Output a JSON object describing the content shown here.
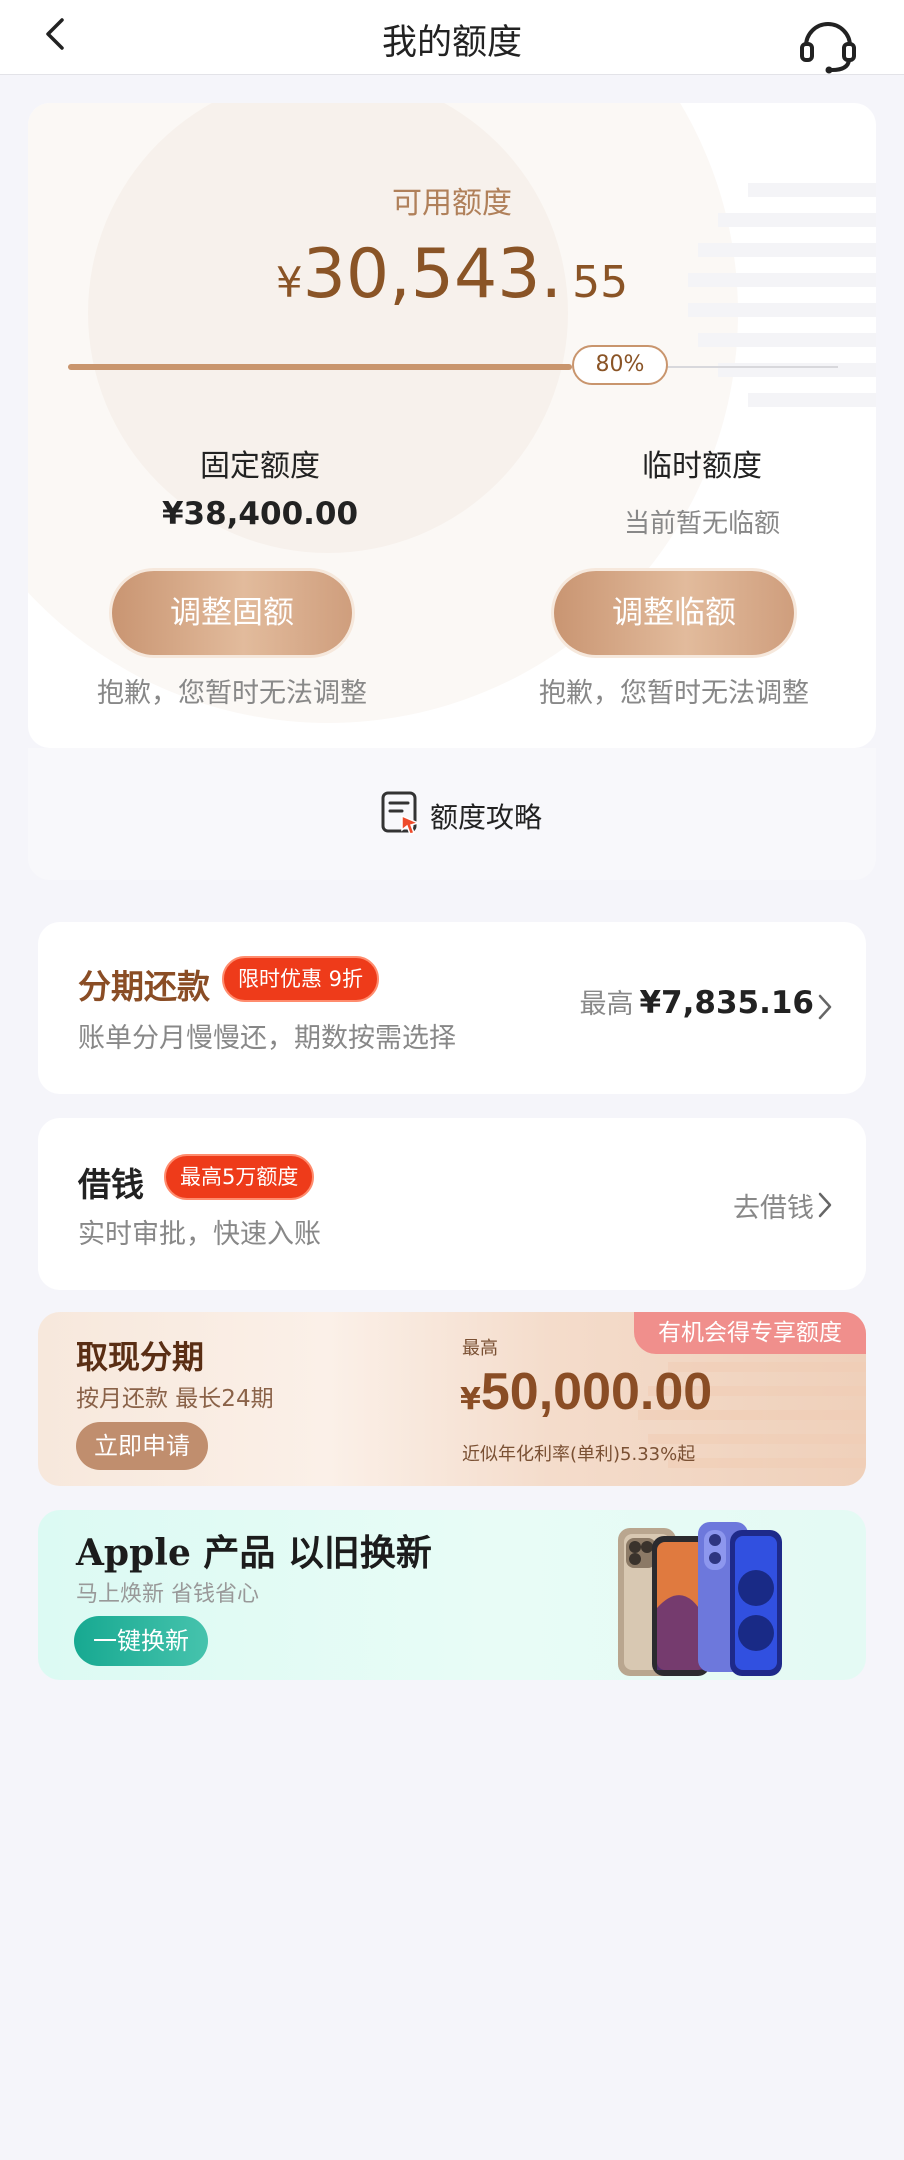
{
  "header": {
    "title": "我的额度"
  },
  "quota": {
    "available_label": "可用额度",
    "currency": "¥",
    "available_main": "30,543.",
    "available_decimal": "55",
    "progress_percent": 80,
    "progress_label": "80%",
    "fixed": {
      "title": "固定额度",
      "amount": "¥38,400.00",
      "button": "调整固额",
      "note": "抱歉，您暂时无法调整"
    },
    "temporary": {
      "title": "临时额度",
      "status": "当前暂无临额",
      "button": "调整临额",
      "note": "抱歉，您暂时无法调整"
    }
  },
  "strategy": {
    "label": "额度攻略"
  },
  "installment": {
    "title": "分期还款",
    "badge": "限时优惠 9折",
    "subtitle": "账单分月慢慢还，期数按需选择",
    "max_label": "最高",
    "max_amount": "¥7,835.16"
  },
  "borrow": {
    "title": "借钱",
    "badge": "最高5万额度",
    "subtitle": "实时审批，快速入账",
    "action": "去借钱"
  },
  "cash_installment": {
    "tag": "有机会得专享额度",
    "title": "取现分期",
    "subtitle": "按月还款 最长24期",
    "button": "立即申请",
    "max_label": "最高",
    "currency": "¥",
    "amount": "50,000.00",
    "rate_note": "近似年化利率(单利)5.33%起"
  },
  "apple_promo": {
    "title": "Apple 产品 以旧换新",
    "subtitle": "马上焕新 省钱省心",
    "button": "一键换新"
  },
  "colors": {
    "accent_brown": "#8a5426",
    "button_gradient_start": "#c99572",
    "badge_red": "#ee3b1a",
    "teal": "#17a991"
  },
  "icons": [
    "back-arrow-icon",
    "customer-service-icon",
    "strategy-doc-icon",
    "chevron-right-icon"
  ]
}
